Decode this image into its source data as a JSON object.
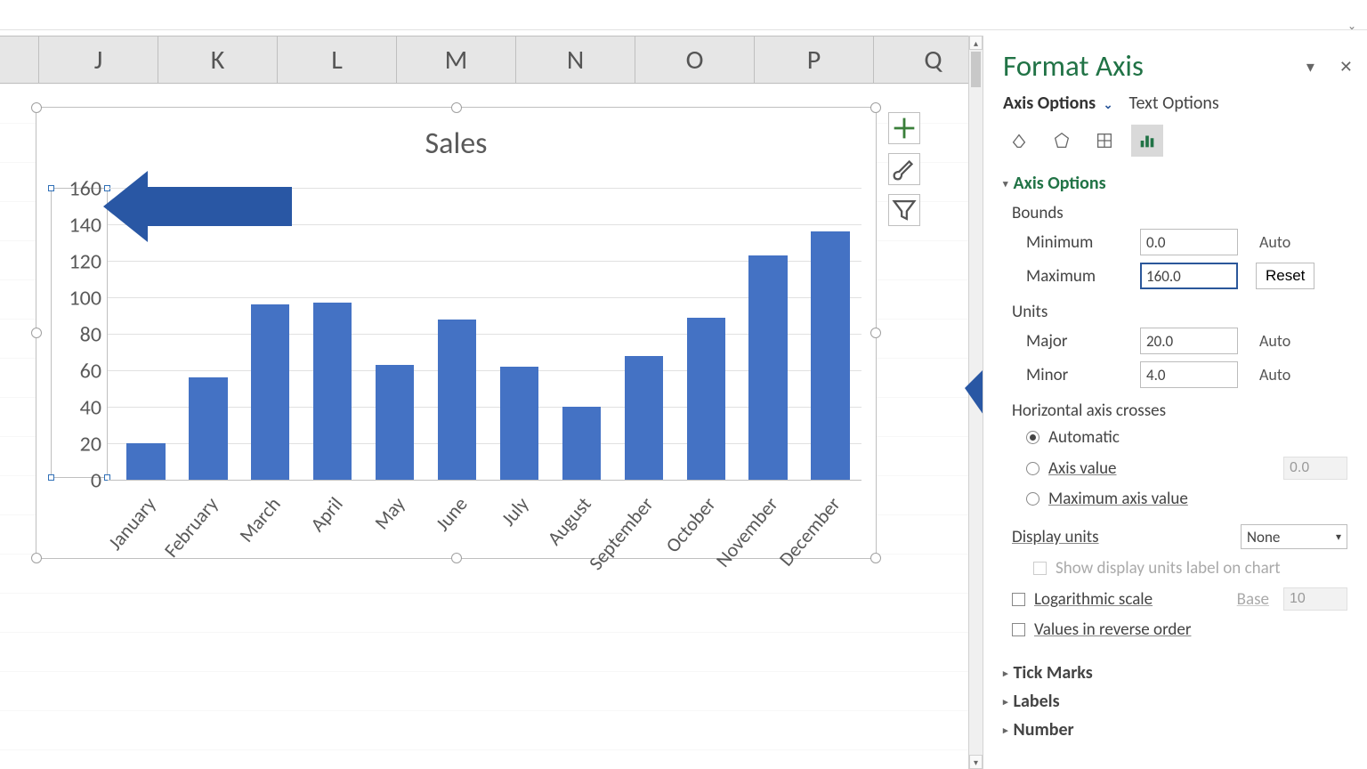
{
  "columns": [
    "J",
    "K",
    "L",
    "M",
    "N",
    "O",
    "P",
    "Q"
  ],
  "sidebar_buttons": {
    "plus": "+",
    "brush": "brush",
    "funnel": "funnel"
  },
  "chart_data": {
    "type": "bar",
    "title": "Sales",
    "categories": [
      "January",
      "February",
      "March",
      "April",
      "May",
      "June",
      "July",
      "August",
      "September",
      "October",
      "November",
      "December"
    ],
    "values": [
      20,
      56,
      96,
      97,
      63,
      88,
      62,
      40,
      68,
      89,
      123,
      136
    ],
    "y_ticks": [
      0,
      20,
      40,
      60,
      80,
      100,
      120,
      140,
      160
    ],
    "xlabel": "",
    "ylabel": "",
    "ylim": [
      0,
      160
    ]
  },
  "pane": {
    "title": "Format Axis",
    "tab_axis": "Axis Options",
    "tab_text": "Text Options",
    "section_axis_options": "Axis Options",
    "bounds_label": "Bounds",
    "min_label": "Minimum",
    "min_value": "0.0",
    "min_side": "Auto",
    "max_label": "Maximum",
    "max_value": "160.0",
    "max_side": "Reset",
    "units_label": "Units",
    "major_label": "Major",
    "major_value": "20.0",
    "major_side": "Auto",
    "minor_label": "Minor",
    "minor_value": "4.0",
    "minor_side": "Auto",
    "hac_label": "Horizontal axis crosses",
    "hac_auto": "Automatic",
    "hac_axisvalue": "Axis value",
    "hac_axisvalue_v": "0.0",
    "hac_max": "Maximum axis value",
    "display_units_label": "Display units",
    "display_units_value": "None",
    "show_display_label": "Show display units label on chart",
    "log_label": "Logarithmic scale",
    "log_base_label": "Base",
    "log_base_value": "10",
    "reverse_label": "Values in reverse order",
    "sec_tickmarks": "Tick Marks",
    "sec_labels": "Labels",
    "sec_number": "Number"
  }
}
